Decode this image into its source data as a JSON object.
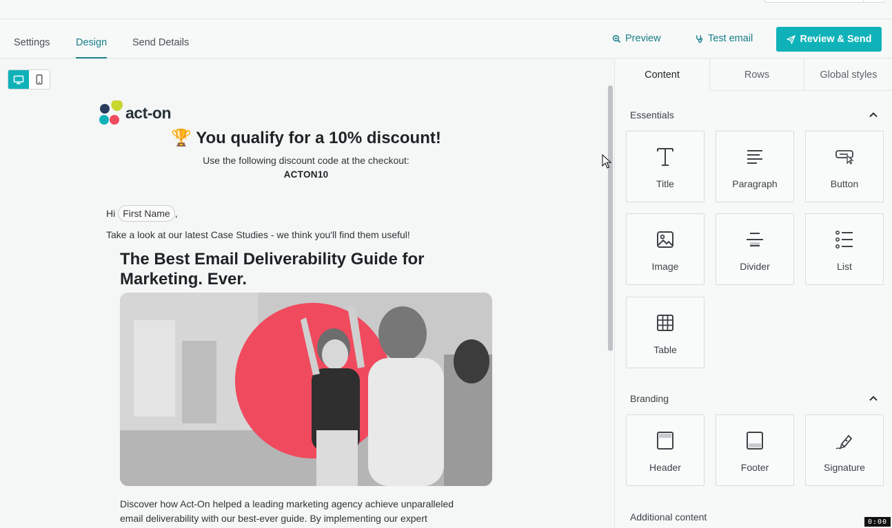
{
  "tabs": {
    "settings": "Settings",
    "design": "Design",
    "send_details": "Send Details"
  },
  "toolbar": {
    "preview": "Preview",
    "test_email": "Test email",
    "review_send": "Review & Send"
  },
  "email": {
    "logo_text": "act-on",
    "headline_emoji": "🏆",
    "headline": "You qualify for a 10% discount!",
    "discount_text": "Use the following discount code at the checkout:",
    "discount_code": "ACTON10",
    "greeting": "Hi",
    "first_name_token": "First Name",
    "greeting_comma": ",",
    "intro": "Take a look at our latest Case Studies - we think you'll find them useful!",
    "guide_title": "The Best Email Deliverability Guide for Marketing. Ever.",
    "description": "Discover how Act-On helped a leading marketing agency achieve unparalleled email deliverability with our best-ever guide. By implementing our expert"
  },
  "panel": {
    "tabs": [
      "Content",
      "Rows",
      "Global styles"
    ],
    "sections": {
      "essentials": "Essentials",
      "branding": "Branding",
      "additional": "Additional content"
    },
    "essentials": [
      "Title",
      "Paragraph",
      "Button",
      "Image",
      "Divider",
      "List",
      "Table"
    ],
    "branding": [
      "Header",
      "Footer",
      "Signature"
    ]
  },
  "timer": "0:00",
  "colors": {
    "accent": "#10b2b9",
    "accent_text": "#177e89",
    "hero_circle": "#f04a5e"
  }
}
